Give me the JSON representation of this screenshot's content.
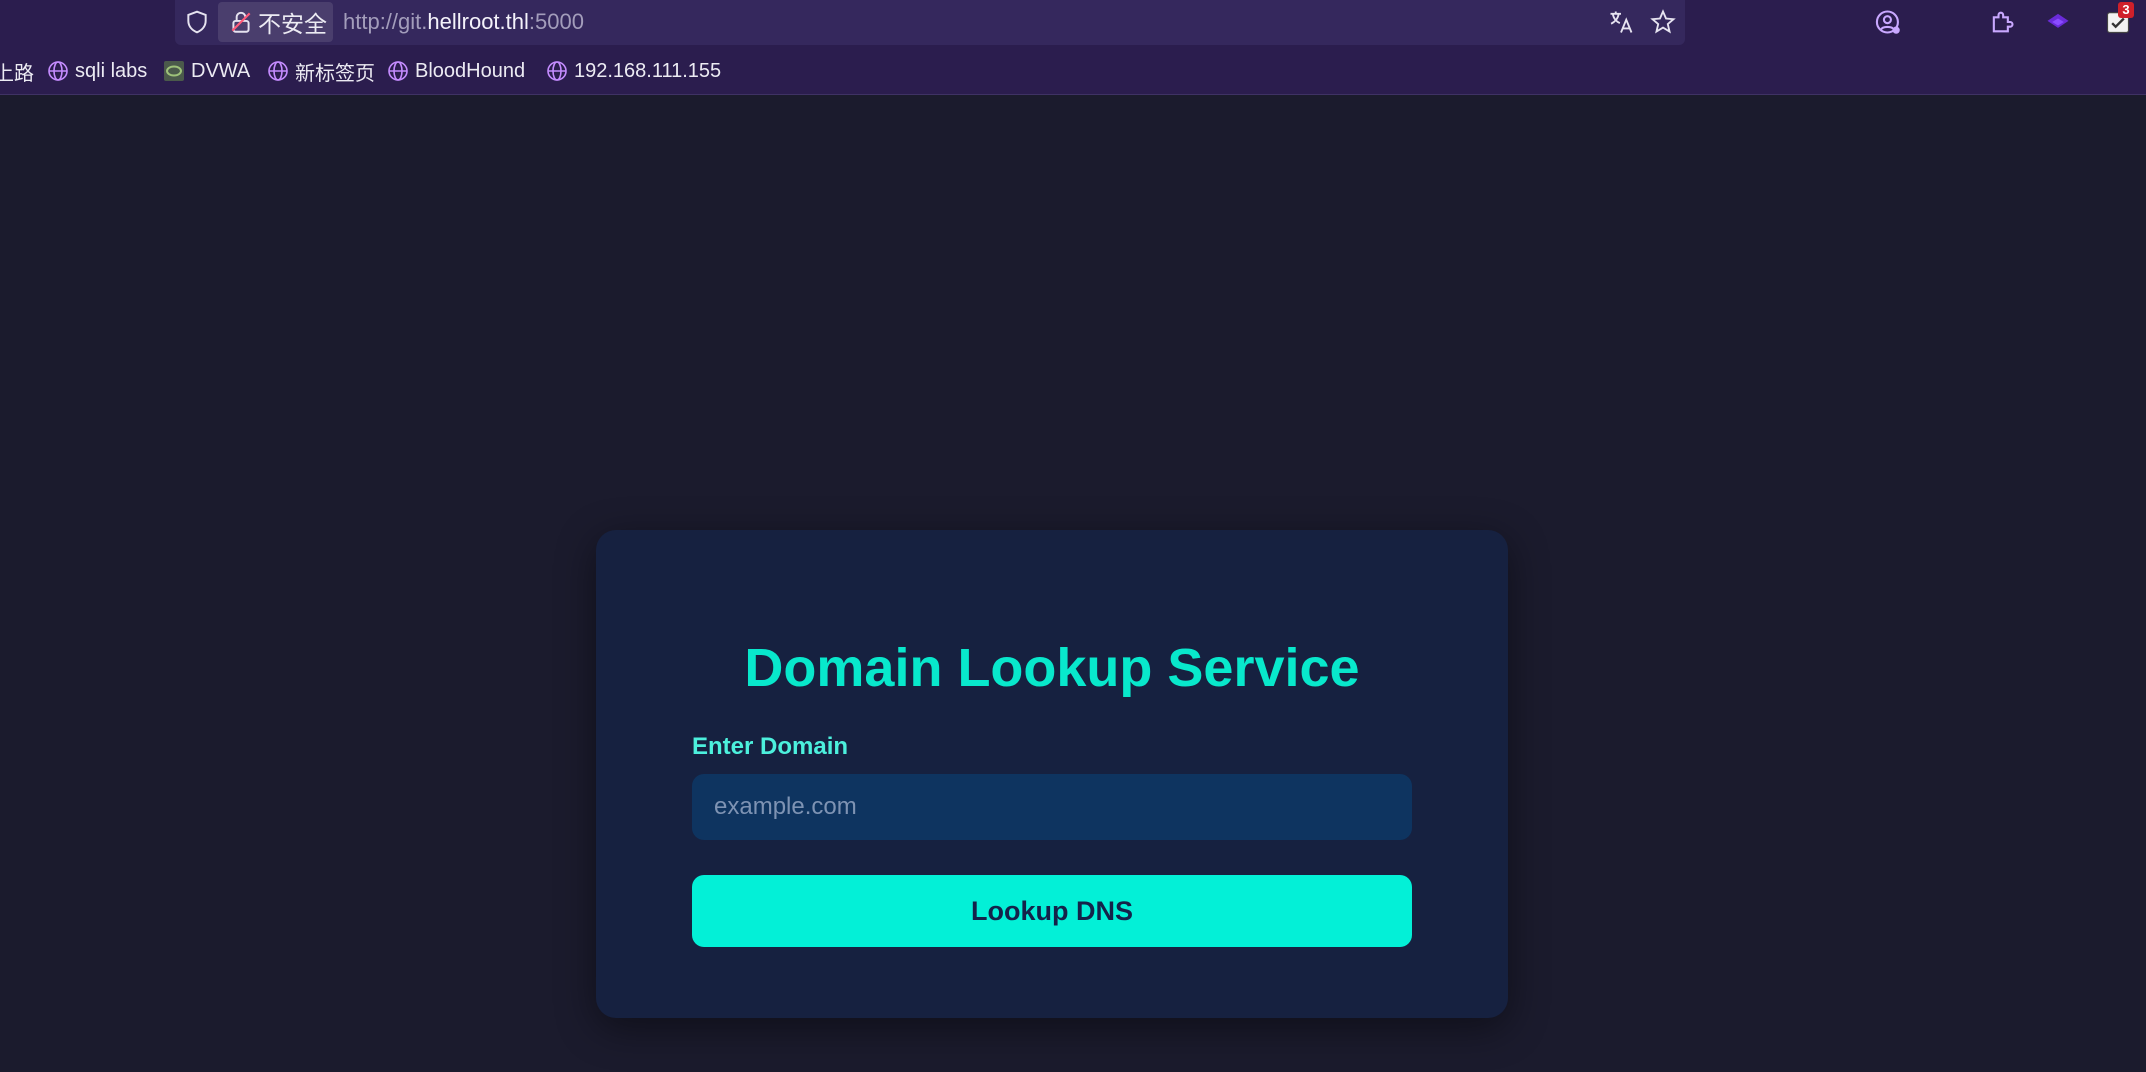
{
  "browser": {
    "security_label": "不安全",
    "url_prefix": "http://git.",
    "url_host": "hellroot.thl",
    "url_suffix": ":5000",
    "extension_badge": "3"
  },
  "bookmarks": [
    {
      "label": "上路",
      "icon": "globe-icon"
    },
    {
      "label": "sqli labs",
      "icon": "globe-icon"
    },
    {
      "label": "DVWA",
      "icon": "dvwa-icon"
    },
    {
      "label": "新标签页",
      "icon": "globe-icon"
    },
    {
      "label": "BloodHound",
      "icon": "globe-icon"
    },
    {
      "label": "192.168.111.155",
      "icon": "globe-icon"
    }
  ],
  "page": {
    "title": "Domain Lookup Service",
    "domain_label": "Enter Domain",
    "domain_placeholder": "example.com",
    "domain_value": "",
    "submit_label": "Lookup DNS"
  },
  "colors": {
    "page_bg": "#1b1b2d",
    "card_bg": "#162140",
    "accent": "#03f0d7",
    "input_bg": "#0e3460",
    "browser_chrome": "#2b1d4e"
  }
}
